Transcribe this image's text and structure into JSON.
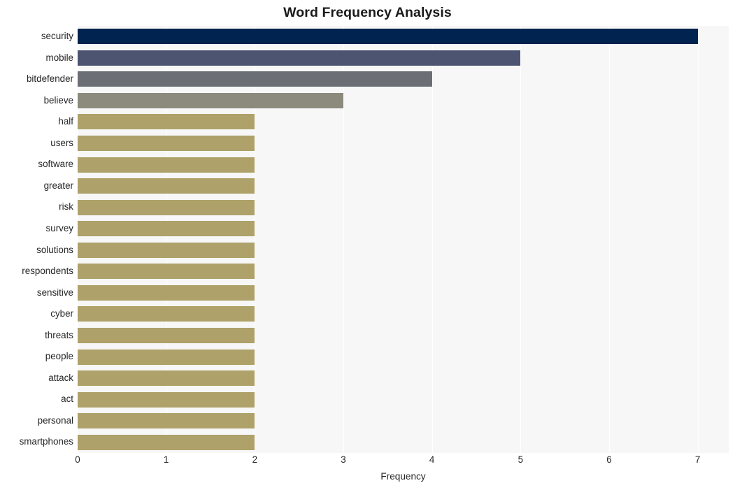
{
  "chart_data": {
    "type": "bar",
    "orientation": "horizontal",
    "title": "Word Frequency Analysis",
    "xlabel": "Frequency",
    "ylabel": "",
    "xlim": [
      0,
      7.35
    ],
    "ylim": [
      0,
      20
    ],
    "grid": true,
    "legend": null,
    "xticks": [
      "0",
      "1",
      "2",
      "3",
      "4",
      "5",
      "6",
      "7"
    ],
    "xtick_values": [
      0,
      1,
      2,
      3,
      4,
      5,
      6,
      7
    ],
    "categories": [
      "security",
      "mobile",
      "bitdefender",
      "believe",
      "half",
      "users",
      "software",
      "greater",
      "risk",
      "survey",
      "solutions",
      "respondents",
      "sensitive",
      "cyber",
      "threats",
      "people",
      "attack",
      "act",
      "personal",
      "smartphones"
    ],
    "values": [
      7,
      5,
      4,
      3,
      2,
      2,
      2,
      2,
      2,
      2,
      2,
      2,
      2,
      2,
      2,
      2,
      2,
      2,
      2,
      2
    ],
    "bar_colors": [
      "#00244f",
      "#4c5472",
      "#6b6e75",
      "#8c8a7c",
      "#aea169",
      "#aea169",
      "#aea169",
      "#aea169",
      "#aea169",
      "#aea169",
      "#aea169",
      "#aea169",
      "#aea169",
      "#aea169",
      "#aea169",
      "#aea169",
      "#aea169",
      "#aea169",
      "#aea169",
      "#aea169"
    ],
    "plot_background": "#f7f7f7",
    "figure_background": "#ffffff",
    "gridline_color": "#ffffff",
    "text_color": "#262626"
  }
}
